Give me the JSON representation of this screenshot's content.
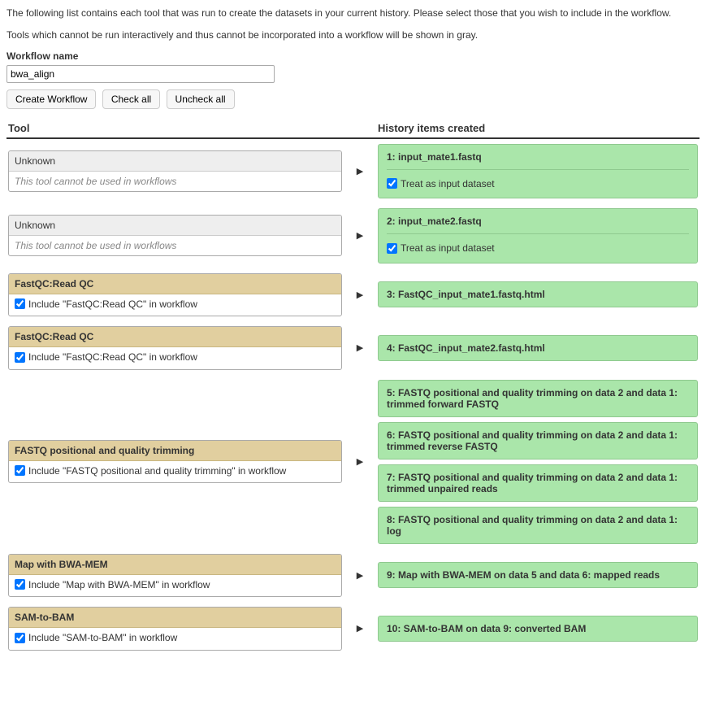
{
  "intro": {
    "p1": "The following list contains each tool that was run to create the datasets in your current history. Please select those that you wish to include in the workflow.",
    "p2": "Tools which cannot be run interactively and thus cannot be incorporated into a workflow will be shown in gray."
  },
  "nameLabel": "Workflow name",
  "nameValue": "bwa_align",
  "buttons": {
    "create": "Create Workflow",
    "checkAll": "Check all",
    "uncheckAll": "Uncheck all"
  },
  "headers": {
    "tool": "Tool",
    "history": "History items created"
  },
  "treatLabel": "Treat as input dataset",
  "rows": [
    {
      "type": "unknown",
      "title": "Unknown",
      "note": "This tool cannot be used in workflows",
      "history": [
        {
          "label": "1: input_mate1.fastq",
          "treat": true
        }
      ]
    },
    {
      "type": "unknown",
      "title": "Unknown",
      "note": "This tool cannot be used in workflows",
      "history": [
        {
          "label": "2: input_mate2.fastq",
          "treat": true
        }
      ]
    },
    {
      "type": "tool",
      "title": "FastQC:Read QC",
      "includeLabel": "Include \"FastQC:Read QC\" in workflow",
      "history": [
        {
          "label": "3: FastQC_input_mate1.fastq.html"
        }
      ]
    },
    {
      "type": "tool",
      "title": "FastQC:Read QC",
      "includeLabel": "Include \"FastQC:Read QC\" in workflow",
      "history": [
        {
          "label": "4: FastQC_input_mate2.fastq.html"
        }
      ]
    },
    {
      "type": "tool",
      "title": "FASTQ positional and quality trimming",
      "includeLabel": "Include \"FASTQ positional and quality trimming\" in workflow",
      "history": [
        {
          "label": "5: FASTQ positional and quality trimming on data 2 and data 1: trimmed forward FASTQ"
        },
        {
          "label": "6: FASTQ positional and quality trimming on data 2 and data 1: trimmed reverse FASTQ"
        },
        {
          "label": "7: FASTQ positional and quality trimming on data 2 and data 1: trimmed unpaired reads"
        },
        {
          "label": "8: FASTQ positional and quality trimming on data 2 and data 1: log"
        }
      ]
    },
    {
      "type": "tool",
      "title": "Map with BWA-MEM",
      "includeLabel": "Include \"Map with BWA-MEM\" in workflow",
      "history": [
        {
          "label": "9: Map with BWA-MEM on data 5 and data 6: mapped reads"
        }
      ]
    },
    {
      "type": "tool",
      "title": "SAM-to-BAM",
      "includeLabel": "Include \"SAM-to-BAM\" in workflow",
      "history": [
        {
          "label": "10: SAM-to-BAM on data 9: converted BAM"
        }
      ]
    }
  ]
}
